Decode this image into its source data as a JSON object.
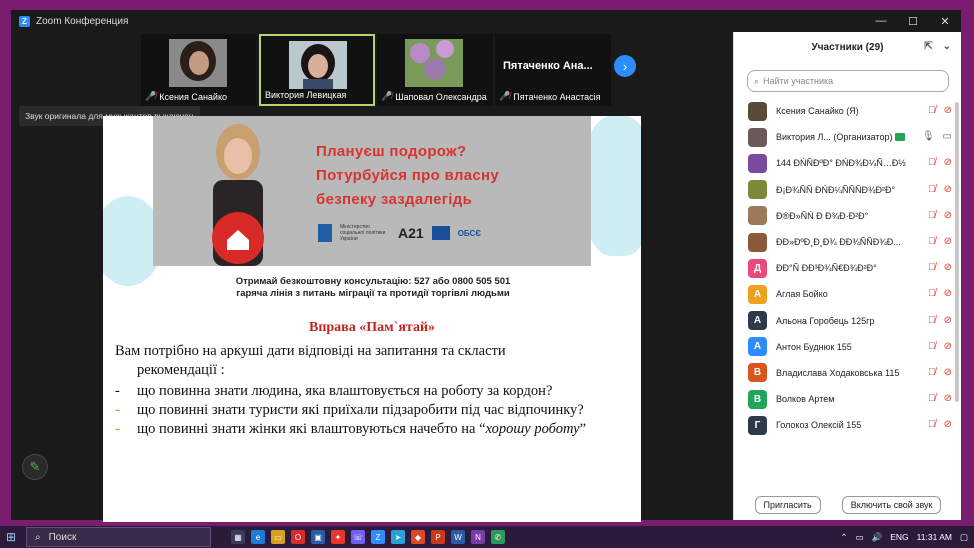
{
  "window": {
    "title": "Zoom Конференция",
    "controls": [
      "—",
      "☐",
      "✕"
    ]
  },
  "thumbnails": [
    {
      "name": "Ксения Санайко",
      "muted": true,
      "has_photo": true
    },
    {
      "name": "Виктория Левицкая",
      "muted": false,
      "has_photo": true,
      "active": true
    },
    {
      "name": "Шаповал Олександра",
      "muted": true,
      "has_photo": true
    },
    {
      "name": "Пятаченко Анастасія",
      "muted": true,
      "has_photo": false,
      "big_label": "Пятаченко Ана..."
    }
  ],
  "notice": "Звук оригинала для музыкантов выключен",
  "slide": {
    "headline": [
      "Плануєш подорож?",
      "Потурбуйся про власну",
      "безпеку заздалегідь"
    ],
    "logos": [
      "Міністерство соціальної політики України",
      "A21",
      "ОБСЄ"
    ],
    "consult_line1": "Отримай безкоштовну консультацію: 527 або 0800 505 501",
    "consult_line2": "гаряча лінія з питань міграції та протидії торгівлі людьми",
    "exercise_title": "Вправа «Пам`ятай»",
    "intro_a": "Вам потрібно  на аркуші дати відповіді на запитання та скласти",
    "intro_b": "рекомендації :",
    "bullets": [
      {
        "dash": "-",
        "text": "що повинна знати людина, яка влаштовується на роботу за кордон?"
      },
      {
        "dash": "-",
        "text": "що повинні знати туристи які приїхали підзаробити під час відпочинку?"
      },
      {
        "dash": "-",
        "text_a": "що повинні знати жінки які влаштовуються начебто на “",
        "text_em": "хорошу роботу",
        "text_b": "”"
      }
    ]
  },
  "panel": {
    "title": "Участники (29)",
    "search_placeholder": "Найти участника",
    "participants": [
      {
        "name": "Ксения Санайко (Я)",
        "avatar_color": "#5a4a3a",
        "avatar_letter": "",
        "mic": "off",
        "cam": "off"
      },
      {
        "name": "Виктория Л... (Организатор)",
        "avatar_color": "#6a5a5a",
        "avatar_letter": "",
        "mic": "on",
        "cam": "on",
        "sharing": true
      },
      {
        "name": "144 ÐŃÑÐºÐ° ÐŃÐ¾Ð¼Ñ…Ð½",
        "avatar_color": "#7b4a9c",
        "avatar_letter": "",
        "mic": "off",
        "cam": "off"
      },
      {
        "name": "Ð¡Ð¾ÑÑ ÐŃÐ¼ÑÑÑÐ¾Ð²Ð°",
        "avatar_color": "#7a8a3a",
        "avatar_letter": "",
        "mic": "off",
        "cam": "off"
      },
      {
        "name": "Ð®Ð»ÑŃ Ð Ð¾Ð·Ð²Ð°",
        "avatar_color": "#9a7a5a",
        "avatar_letter": "",
        "mic": "off",
        "cam": "off"
      },
      {
        "name": "ÐÐ»ÐºÐ¸Ð¸Ð¾ ÐÐ¾ÑÑÐ¾Ð...",
        "avatar_color": "#8a5a3a",
        "avatar_letter": "",
        "mic": "off",
        "cam": "off"
      },
      {
        "name": "ÐÐ°Ñ ÐÐ³Ð¾Ñ€Ð¾Ð²Ð°",
        "avatar_color": "#e84a7a",
        "avatar_letter": "Д",
        "mic": "off",
        "cam": "off"
      },
      {
        "name": "Аглая Бойко",
        "avatar_color": "#f0a020",
        "avatar_letter": "А",
        "mic": "off",
        "cam": "off"
      },
      {
        "name": "Альона Горобець 125гр",
        "avatar_color": "#2d3a4a",
        "avatar_letter": "А",
        "mic": "off",
        "cam": "off"
      },
      {
        "name": "Антон Буднюк 155",
        "avatar_color": "#2d8cff",
        "avatar_letter": "А",
        "mic": "off",
        "cam": "off"
      },
      {
        "name": "Владислава Ходаковська 115",
        "avatar_color": "#d9541e",
        "avatar_letter": "В",
        "mic": "off",
        "cam": "off"
      },
      {
        "name": "Волков Артем",
        "avatar_color": "#23a559",
        "avatar_letter": "В",
        "mic": "off",
        "cam": "off"
      },
      {
        "name": "Голокоз Олексій 155",
        "avatar_color": "#2d3a4a",
        "avatar_letter": "Г",
        "mic": "off",
        "cam": "off"
      }
    ],
    "invite_button": "Пригласить",
    "unmute_button": "Включить свой звук"
  },
  "taskbar": {
    "search_label": "Поиск",
    "lang": "ENG",
    "time": "11:31 AM"
  },
  "colors": {
    "accent": "#2d8cff",
    "mute_red": "#e0352b",
    "frame": "#7a1d6e"
  }
}
